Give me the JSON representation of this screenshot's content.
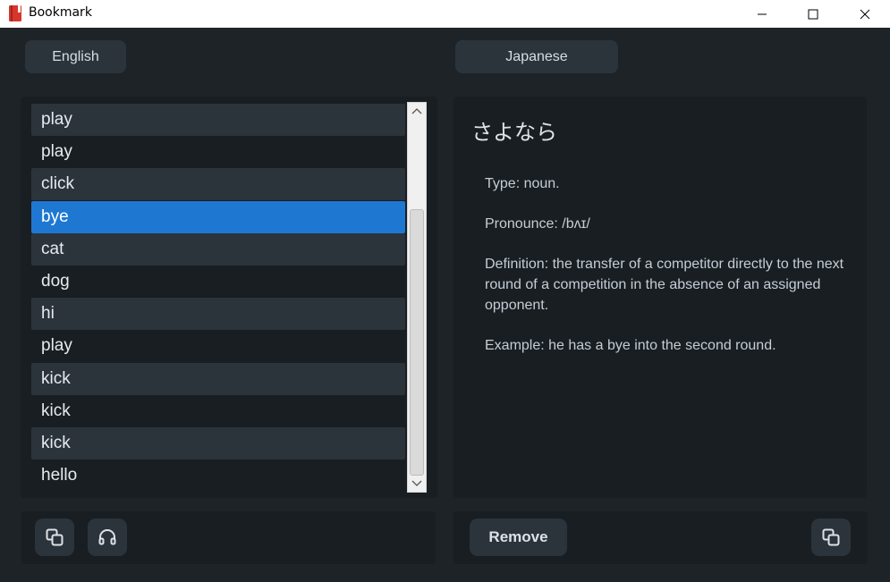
{
  "window": {
    "title": "Bookmark"
  },
  "languages": {
    "source": "English",
    "target": "Japanese"
  },
  "word_list": {
    "items": [
      {
        "label": "play",
        "style": "alt"
      },
      {
        "label": "play",
        "style": "plain"
      },
      {
        "label": "click",
        "style": "alt"
      },
      {
        "label": "bye",
        "style": "selected"
      },
      {
        "label": "cat",
        "style": "alt"
      },
      {
        "label": "dog",
        "style": "plain"
      },
      {
        "label": "hi",
        "style": "alt"
      },
      {
        "label": "play",
        "style": "plain"
      },
      {
        "label": "kick",
        "style": "alt"
      },
      {
        "label": "kick",
        "style": "plain"
      },
      {
        "label": "kick",
        "style": "alt"
      },
      {
        "label": "hello",
        "style": "plain"
      }
    ],
    "selected_index": 3
  },
  "definition": {
    "word": "さよなら",
    "type": "Type: noun.",
    "pronounce": "Pronounce: /bʌɪ/",
    "definition": "Definition: the transfer of a competitor directly to the next round of a competition in the absence of an assigned opponent.",
    "example": "Example: he has a bye into the second round."
  },
  "toolbar": {
    "remove_label": "Remove"
  },
  "icons": {
    "left_copy": "copy-icon",
    "listen": "headphones-icon",
    "right_copy": "copy-icon"
  },
  "colors": {
    "background": "#1e2327",
    "panel": "#191e22",
    "button": "#2c343b",
    "selection": "#1e78d2"
  }
}
